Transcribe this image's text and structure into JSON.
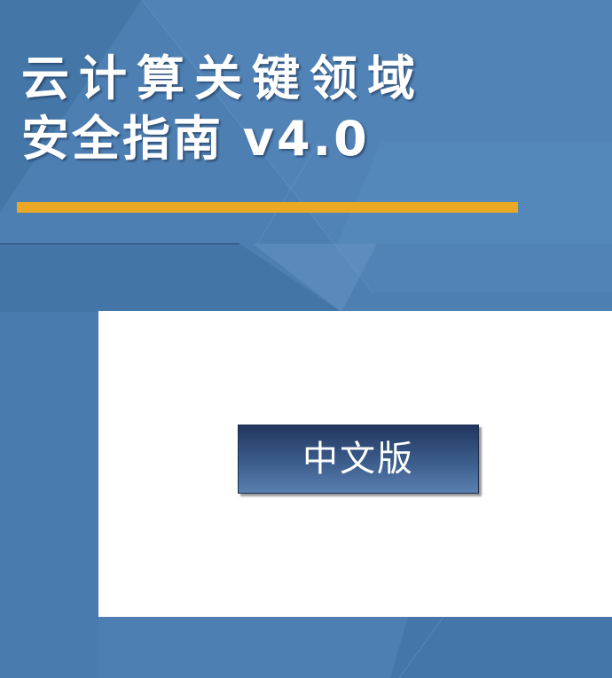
{
  "document": {
    "title_line_1": "云计算关键领域",
    "title_line_2": "安全指南 v4.0",
    "edition_label": "中文版"
  },
  "colors": {
    "background_blue": "#4d7fb3",
    "accent_orange": "#eaa824",
    "panel_white": "#ffffff",
    "badge_navy": "#2a4470"
  }
}
